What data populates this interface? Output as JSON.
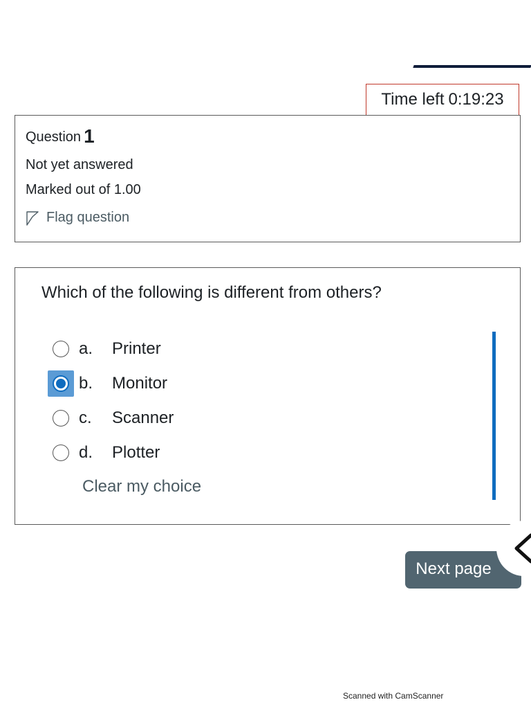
{
  "timer": {
    "label": "Time left",
    "value": "0:19:23",
    "border_color": "#c0392b"
  },
  "question_info": {
    "label": "Question",
    "number": "1",
    "state": "Not yet answered",
    "grade": "Marked out of 1.00",
    "flag_label": "Flag question",
    "flag_icon": "flag-outline-icon"
  },
  "question": {
    "text": "Which of the following is different from others?",
    "answers": [
      {
        "letter": "a.",
        "label": "Printer",
        "selected": false
      },
      {
        "letter": "b.",
        "label": "Monitor",
        "selected": true
      },
      {
        "letter": "c.",
        "label": "Scanner",
        "selected": false
      },
      {
        "letter": "d.",
        "label": "Plotter",
        "selected": false
      }
    ],
    "clear_label": "Clear my choice"
  },
  "navigation": {
    "next_label": "Next page",
    "drawer_icon": "chevron-left-icon",
    "button_color": "#516570"
  },
  "footer": {
    "scan_watermark": "Scanned with CamScanner"
  },
  "colors": {
    "accent": "#0f6cbf",
    "focus": "#5b9bd5"
  }
}
